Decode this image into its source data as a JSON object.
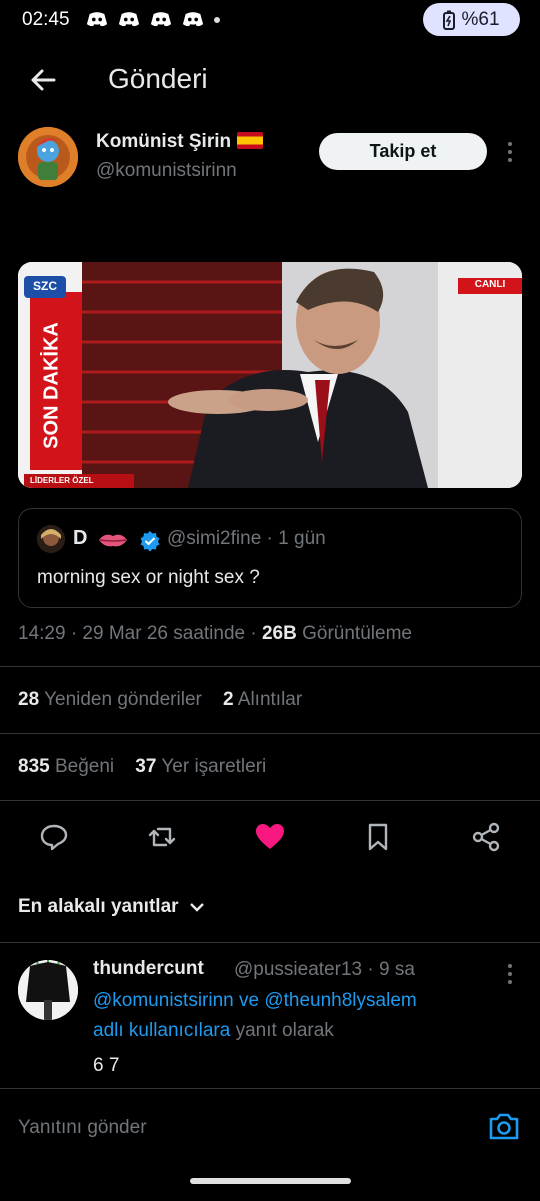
{
  "status": {
    "time": "02:45",
    "battery": "%61"
  },
  "header": {
    "title": "Gönderi"
  },
  "post": {
    "author_name": "Komünist Şirin",
    "author_handle": "@komunistsirinn",
    "follow_label": "Takip et",
    "media": {
      "logo": "SZC",
      "banner": "SON DAKİKA",
      "live": "CANLI",
      "footer": "LİDERLER ÖZEL"
    },
    "quoted": {
      "name": "D",
      "handle": "@simi2fine",
      "time": "· 1 gün",
      "text": "morning sex or night sex ?"
    },
    "meta": {
      "time": "14:29 · 29 Mar 26 saatinde ·",
      "views_count": "26B",
      "views_label": "Görüntüleme"
    },
    "stats": {
      "reposts_count": "28",
      "reposts_label": "Yeniden gönderiler",
      "quotes_count": "2",
      "quotes_label": "Alıntılar",
      "likes_count": "835",
      "likes_label": "Beğeni",
      "bookmarks_count": "37",
      "bookmarks_label": "Yer işaretleri"
    }
  },
  "replies": {
    "filter_label": "En alakalı yanıtlar",
    "items": [
      {
        "name": "thundercunt",
        "handle": "@pussieater13 · 9 sa",
        "reply_to_line1": "@komunistsirinn ve @theunh8lysalem",
        "reply_to_line2_link": "adlı kullanıcılara",
        "reply_to_line2_rest": " yanıt olarak",
        "body": "6 7"
      }
    ]
  },
  "composer": {
    "placeholder": "Yanıtını gönder"
  },
  "colors": {
    "accent": "#1d9bf0",
    "like": "#f91880",
    "background": "#000000"
  }
}
